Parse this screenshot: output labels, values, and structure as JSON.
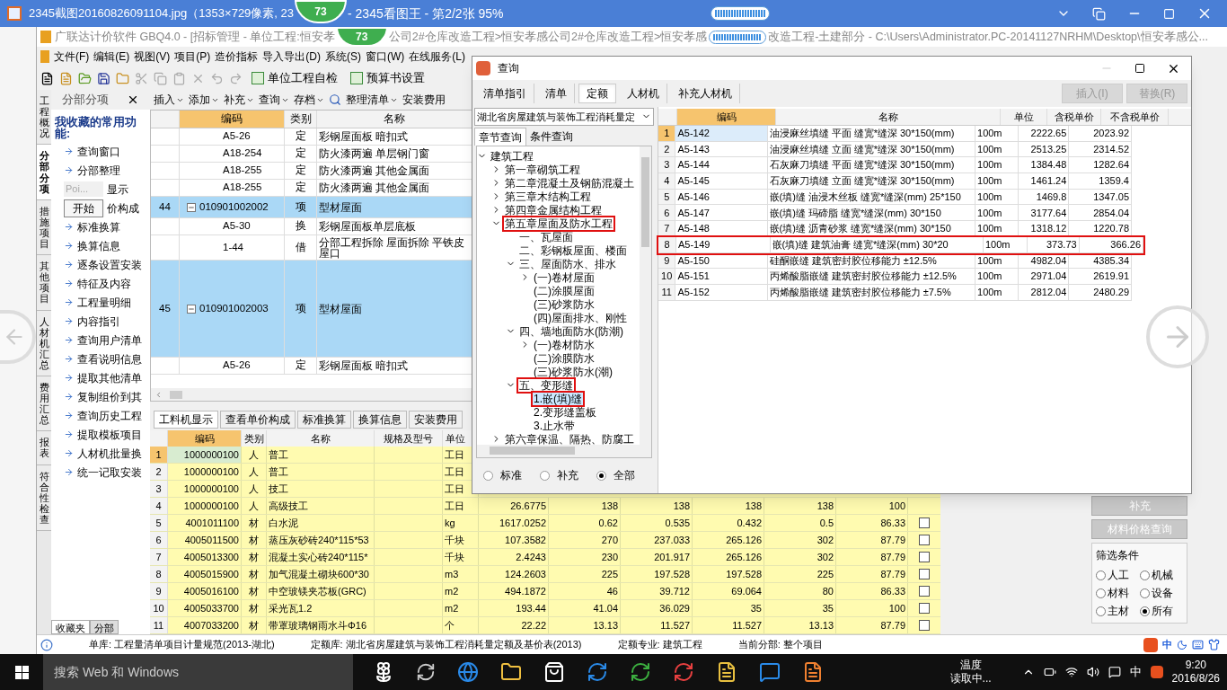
{
  "viewer": {
    "title_before": "2345截图20160826091104.jpg（1353×729像素, 23",
    "title_after": "- 2345看图王 - 第2/2张 95%",
    "badges": [
      "73",
      "73"
    ]
  },
  "app": {
    "title_parts": [
      "广联达计价软件 GBQ4.0 - [招标管理 - 单位工程:恒安孝",
      "公司2#仓库改造工程>恒安孝感公司2#仓库改造工程>恒安孝感",
      "改造工程-土建部分 - C:\\Users\\Administrator.PC-20141127NRHM\\Desktop\\恒安孝感公..."
    ],
    "menu": [
      "文件(F)",
      "编辑(E)",
      "视图(V)",
      "项目(P)",
      "造价指标",
      "导入导出(D)",
      "系统(S)",
      "窗口(W)",
      "在线服务(L)"
    ],
    "toolbar_buttons": [
      "单位工程自检",
      "预算书设置"
    ]
  },
  "side_tabs": [
    {
      "label": "工程概况",
      "selected": false
    },
    {
      "label": "分部分项",
      "selected": true
    },
    {
      "label": "措施项目",
      "selected": false
    },
    {
      "label": "其他项目",
      "selected": false
    },
    {
      "label": "人材机汇总",
      "selected": false
    },
    {
      "label": "费用汇总",
      "selected": false
    },
    {
      "label": "报表",
      "selected": false
    },
    {
      "label": "符合性检查",
      "selected": false
    }
  ],
  "bottom_tabs": [
    {
      "label": "收藏夹",
      "selected": true
    },
    {
      "label": "分部",
      "selected": false
    }
  ],
  "panel": {
    "title": "分部分项",
    "heading": "我收藏的常用功能:",
    "items": [
      "查询窗口",
      "分部整理",
      "显示",
      "价构成",
      "标准换算",
      "换算信息",
      "逐条设置安装",
      "特征及内容",
      "工程量明细",
      "内容指引",
      "查询用户清单",
      "查看说明信息",
      "提取其他清单",
      "复制组价到其",
      "查询历史工程",
      "提取模板项目",
      "人材机批量换",
      "统一记取安装"
    ]
  },
  "popup": {
    "text": "Poi...",
    "button": "开始"
  },
  "sub_toolbar": [
    "插入",
    "添加",
    "补充",
    "查询",
    "存档",
    "整理清单",
    "安装费用"
  ],
  "upper_table": {
    "columns": [
      "编码",
      "类别",
      "名称"
    ],
    "rows": [
      {
        "kind": "sub",
        "code": "A5-26",
        "type": "定",
        "name": "彩钢屋面板 暗扣式"
      },
      {
        "kind": "sub",
        "code": "A18-254",
        "type": "定",
        "name": "防火漆两遍 单层钢门窗"
      },
      {
        "kind": "sub",
        "code": "A18-255",
        "type": "定",
        "name": "防火漆两遍 其他金属面"
      },
      {
        "kind": "sub",
        "code": "A18-255",
        "type": "定",
        "name": "防火漆两遍 其他金属面"
      },
      {
        "kind": "item",
        "num": "44",
        "code": "010901002002",
        "type": "项",
        "name": "型材屋面",
        "expanded": true
      },
      {
        "kind": "sub",
        "code": "A5-30",
        "type": "换",
        "name": "彩钢屋面板单层底板"
      },
      {
        "kind": "sub",
        "code": "1-44",
        "type": "借",
        "name": "分部工程拆除 屋面拆除 平铁皮屋口"
      },
      {
        "kind": "item",
        "num": "45",
        "code": "010901002003",
        "type": "项",
        "name": "型材屋面",
        "expanded": true
      },
      {
        "kind": "sub",
        "code": "A5-26",
        "type": "定",
        "name": "彩钢屋面板 暗扣式"
      }
    ]
  },
  "lower_tabs": [
    {
      "label": "工料机显示",
      "selected": true
    },
    {
      "label": "查看单价构成",
      "selected": false
    },
    {
      "label": "标准换算",
      "selected": false
    },
    {
      "label": "换算信息",
      "selected": false
    },
    {
      "label": "安装费用",
      "selected": false
    }
  ],
  "lower_grid": {
    "columns": [
      "编码",
      "类别",
      "名称",
      "规格及型号",
      "单位"
    ],
    "rows": [
      {
        "num": "1",
        "selected": true,
        "cells": [
          "1000000100",
          "人",
          "普工",
          "",
          "工日"
        ]
      },
      {
        "num": "2",
        "selected": false,
        "cells": [
          "1000000100",
          "人",
          "普工",
          "",
          "工日"
        ]
      },
      {
        "num": "3",
        "selected": false,
        "cells": [
          "1000000100",
          "人",
          "技工",
          "",
          "工日"
        ]
      },
      {
        "num": "4",
        "selected": false,
        "cells": [
          "1000000100",
          "人",
          "高级技工",
          "",
          "工日",
          "26.6775",
          "138",
          "138",
          "138",
          "138",
          "100"
        ]
      },
      {
        "num": "5",
        "selected": false,
        "checked": false,
        "cells": [
          "4001011100",
          "材",
          "白水泥",
          "",
          "kg",
          "1617.0252",
          "0.62",
          "0.535",
          "0.432",
          "0.5",
          "86.33"
        ]
      },
      {
        "num": "6",
        "selected": false,
        "checked": false,
        "cells": [
          "4005011500",
          "材",
          "蒸压灰砂砖240*115*53",
          "",
          "千块",
          "107.3582",
          "270",
          "237.033",
          "265.126",
          "302",
          "87.79"
        ]
      },
      {
        "num": "7",
        "selected": false,
        "checked": false,
        "cells": [
          "4005013300",
          "材",
          "混凝土实心砖240*115*",
          "",
          "千块",
          "2.4243",
          "230",
          "201.917",
          "265.126",
          "302",
          "87.79"
        ]
      },
      {
        "num": "8",
        "selected": false,
        "checked": false,
        "cells": [
          "4005015900",
          "材",
          "加气混凝土砌块600*30",
          "",
          "m3",
          "124.2603",
          "225",
          "197.528",
          "197.528",
          "225",
          "87.79"
        ]
      },
      {
        "num": "9",
        "selected": false,
        "checked": false,
        "cells": [
          "4005016100",
          "材",
          "中空玻镁夹芯板(GRC)",
          "",
          "m2",
          "494.1872",
          "46",
          "39.712",
          "69.064",
          "80",
          "86.33"
        ]
      },
      {
        "num": "10",
        "selected": false,
        "checked": false,
        "cells": [
          "4005033700",
          "材",
          "采光瓦1.2",
          "",
          "m2",
          "193.44",
          "41.04",
          "36.029",
          "35",
          "35",
          "100"
        ]
      },
      {
        "num": "11",
        "selected": false,
        "checked": false,
        "cells": [
          "4007033200",
          "材",
          "带罩玻璃钢雨水斗Φ16",
          "",
          "个",
          "22.22",
          "13.13",
          "11.527",
          "11.527",
          "13.13",
          "87.79"
        ]
      }
    ]
  },
  "right_panel": {
    "buttons": [
      "补充",
      "材料价格查询"
    ],
    "filter_title": "筛选条件",
    "filters": [
      {
        "label": "人工",
        "selected": false
      },
      {
        "label": "机械",
        "selected": false
      },
      {
        "label": "材料",
        "selected": false
      },
      {
        "label": "设备",
        "selected": false
      },
      {
        "label": "主材",
        "selected": false
      },
      {
        "label": "所有",
        "selected": true
      }
    ]
  },
  "status_bar": [
    "单库: 工程量清单项目计量规范(2013-湖北)",
    "定额库: 湖北省房屋建筑与装饰工程消耗量定额及基价表(2013)",
    "定额专业: 建筑工程",
    "当前分部: 整个项目"
  ],
  "dialog": {
    "title": "查询",
    "tabs": [
      {
        "label": "清单指引",
        "selected": false
      },
      {
        "label": "清单",
        "selected": false
      },
      {
        "label": "定额",
        "selected": true
      },
      {
        "label": "人材机",
        "selected": false
      },
      {
        "label": "补充人材机",
        "selected": false
      }
    ],
    "actions": [
      {
        "label": "插入(I)",
        "disabled": true
      },
      {
        "label": "替换(R)",
        "disabled": true
      }
    ],
    "library": "湖北省房屋建筑与装饰工程消耗量定",
    "sub_tabs": [
      {
        "label": "章节查询",
        "selected": true
      },
      {
        "label": "条件查询",
        "selected": false
      }
    ],
    "tree": [
      {
        "label": "建筑工程",
        "expanded": true,
        "children": [
          {
            "label": "第一章砌筑工程",
            "expanded": false
          },
          {
            "label": "第二章混凝土及钢筋混凝土",
            "expanded": false
          },
          {
            "label": "第三章木结构工程",
            "expanded": false
          },
          {
            "label": "第四章金属结构工程",
            "expanded": false
          },
          {
            "label": "第五章屋面及防水工程",
            "expanded": true,
            "annotated": true,
            "children": [
              {
                "label": "一、瓦屋面"
              },
              {
                "label": "二、彩钢板屋面、楼面"
              },
              {
                "label": "三、屋面防水、排水",
                "expanded": true,
                "children": [
                  {
                    "label": "(一)卷材屋面",
                    "expanded": false
                  },
                  {
                    "label": "(二)涂膜屋面"
                  },
                  {
                    "label": "(三)砂浆防水"
                  },
                  {
                    "label": "(四)屋面排水、刚性"
                  }
                ]
              },
              {
                "label": "四、墙地面防水(防潮)",
                "expanded": true,
                "children": [
                  {
                    "label": "(一)卷材防水",
                    "expanded": false
                  },
                  {
                    "label": "(二)涂膜防水"
                  },
                  {
                    "label": "(三)砂浆防水(潮)"
                  }
                ]
              },
              {
                "label": "五、变形缝",
                "expanded": true,
                "annotated": true,
                "children": [
                  {
                    "label": "1.嵌(填)缝",
                    "selected": true,
                    "annotated": true
                  },
                  {
                    "label": "2.变形缝盖板",
                    "selected": false
                  },
                  {
                    "label": "3.止水带",
                    "selected": false
                  }
                ]
              }
            ]
          },
          {
            "label": "第六章保温、隔热、防腐工",
            "expanded": false
          }
        ]
      }
    ],
    "scope": [
      {
        "label": "标准",
        "selected": false
      },
      {
        "label": "补充",
        "selected": false
      },
      {
        "label": "全部",
        "selected": true
      }
    ],
    "table": {
      "columns": [
        "编码",
        "名称",
        "单位",
        "含税单价",
        "不含税单价"
      ],
      "rows": [
        {
          "num": "1",
          "selected": true,
          "annotated": false,
          "code": "A5-142",
          "name": "油浸麻丝填缝 平面 缝宽*缝深 30*150(mm)",
          "unit": "100m",
          "tax": "2222.65",
          "notax": "2023.92"
        },
        {
          "num": "2",
          "selected": false,
          "annotated": false,
          "code": "A5-143",
          "name": "油浸麻丝填缝 立面 缝宽*缝深 30*150(mm)",
          "unit": "100m",
          "tax": "2513.25",
          "notax": "2314.52"
        },
        {
          "num": "3",
          "selected": false,
          "annotated": false,
          "code": "A5-144",
          "name": "石灰麻刀填缝 平面 缝宽*缝深 30*150(mm)",
          "unit": "100m",
          "tax": "1384.48",
          "notax": "1282.64"
        },
        {
          "num": "4",
          "selected": false,
          "annotated": false,
          "code": "A5-145",
          "name": "石灰麻刀填缝 立面 缝宽*缝深 30*150(mm)",
          "unit": "100m",
          "tax": "1461.24",
          "notax": "1359.4"
        },
        {
          "num": "5",
          "selected": false,
          "annotated": false,
          "code": "A5-146",
          "name": "嵌(填)缝 油浸木丝板 缝宽*缝深(mm) 25*150",
          "unit": "100m",
          "tax": "1469.8",
          "notax": "1347.05"
        },
        {
          "num": "6",
          "selected": false,
          "annotated": false,
          "code": "A5-147",
          "name": "嵌(填)缝 玛碲脂 缝宽*缝深(mm) 30*150",
          "unit": "100m",
          "tax": "3177.64",
          "notax": "2854.04"
        },
        {
          "num": "7",
          "selected": false,
          "annotated": false,
          "code": "A5-148",
          "name": "嵌(填)缝 沥青砂浆 缝宽*缝深(mm) 30*150",
          "unit": "100m",
          "tax": "1318.12",
          "notax": "1220.78"
        },
        {
          "num": "8",
          "selected": false,
          "annotated": true,
          "code": "A5-149",
          "name": "嵌(填)缝 建筑油膏 缝宽*缝深(mm) 30*20",
          "unit": "100m",
          "tax": "373.73",
          "notax": "366.26"
        },
        {
          "num": "9",
          "selected": false,
          "annotated": false,
          "code": "A5-150",
          "name": "硅酮嵌缝 建筑密封胶位移能力 ±12.5%",
          "unit": "100m",
          "tax": "4982.04",
          "notax": "4385.34"
        },
        {
          "num": "10",
          "selected": false,
          "annotated": false,
          "code": "A5-151",
          "name": "丙烯酸脂嵌缝 建筑密封胶位移能力 ±12.5%",
          "unit": "100m",
          "tax": "2971.04",
          "notax": "2619.91"
        },
        {
          "num": "11",
          "selected": false,
          "annotated": false,
          "code": "A5-152",
          "name": "丙烯酸脂嵌缝 建筑密封胶位移能力 ±7.5%",
          "unit": "100m",
          "tax": "2812.04",
          "notax": "2480.29"
        }
      ]
    }
  },
  "ime": {
    "label": "中"
  },
  "taskbar": {
    "search": "搜索 Web 和 Windows",
    "weather": [
      "温度",
      "读取中..."
    ],
    "ime": "中",
    "time": "9:20",
    "date": "2016/8/26"
  }
}
